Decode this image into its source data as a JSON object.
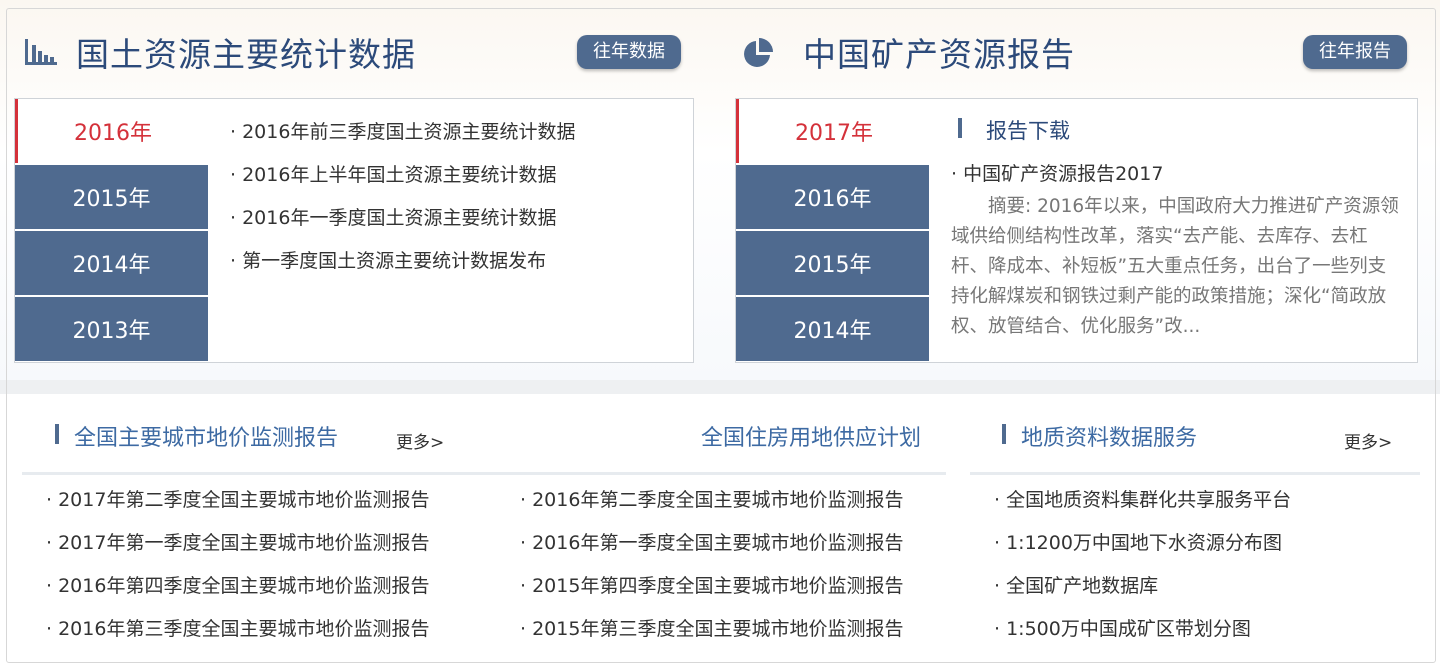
{
  "stats": {
    "title": "国土资源主要统计数据",
    "button": "往年数据",
    "active_year": "2016年",
    "years": [
      "2015年",
      "2014年",
      "2013年"
    ],
    "items": [
      "2016年前三季度国土资源主要统计数据",
      "2016年上半年国土资源主要统计数据",
      "2016年一季度国土资源主要统计数据",
      "第一季度国土资源主要统计数据发布"
    ],
    "icon": "bar-chart-icon"
  },
  "report": {
    "title": "中国矿产资源报告",
    "button": "往年报告",
    "active_year": "2017年",
    "years": [
      "2016年",
      "2015年",
      "2014年"
    ],
    "section_head": "报告下载",
    "item": "中国矿产资源报告2017",
    "summary": "摘要: 2016年以来，中国政府大力推进矿产资源领域供给侧结构性改革，落实“去产能、去库存、去杠杆、降成本、补短板”五大重点任务，出台了一些列支持化解煤炭和钢铁过剩产能的政策措施；深化“简政放权、放管结合、优化服务”改...",
    "icon": "pie-chart-icon"
  },
  "land_price": {
    "title": "全国主要城市地价监测报告",
    "more": "更多>",
    "left_items": [
      "2017年第二季度全国主要城市地价监测报告",
      "2017年第一季度全国主要城市地价监测报告",
      "2016年第四季度全国主要城市地价监测报告",
      "2016年第三季度全国主要城市地价监测报告"
    ],
    "right_title": "全国住房用地供应计划",
    "right_items": [
      "2016年第二季度全国主要城市地价监测报告",
      "2016年第一季度全国主要城市地价监测报告",
      "2015年第四季度全国主要城市地价监测报告",
      "2015年第三季度全国主要城市地价监测报告"
    ]
  },
  "geo": {
    "title": "地质资料数据服务",
    "more": "更多>",
    "items": [
      "全国地质资料集群化共享服务平台",
      "1:1200万中国地下水资源分布图",
      "全国矿产地数据库",
      "1:500万中国成矿区带划分图"
    ]
  },
  "colors": {
    "accent": "#4f6a8f",
    "title": "#2c4a7a",
    "active": "#d4313a",
    "link": "#3d6aa3"
  }
}
